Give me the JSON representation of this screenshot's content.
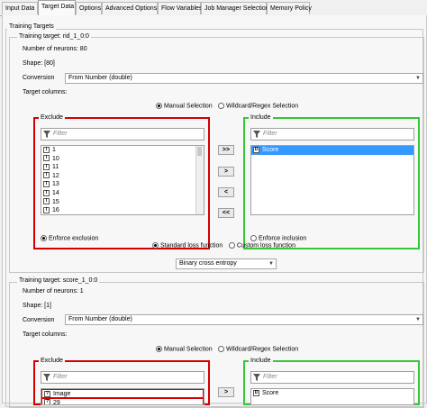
{
  "tabs": [
    "Input Data",
    "Target Data",
    "Options",
    "Advanced Options",
    "Flow Variables",
    "Job Manager Selection",
    "Memory Policy"
  ],
  "active_tab": "Target Data",
  "section_title": "Training Targets",
  "target1": {
    "title": "Training target: rid_1_0:0",
    "neurons": "Number of neurons: 80",
    "shape": "Shape: [80]",
    "conversion_label": "Conversion",
    "conversion_value": "From Number (double)",
    "target_columns_label": "Target columns:",
    "manual_selection": "Manual Selection",
    "wildcard_selection": "Wildcard/Regex Selection",
    "exclude_title": "Exclude",
    "include_title": "Include",
    "filter_placeholder": "Filter",
    "exclude_items": [
      {
        "type": "I",
        "name": "1"
      },
      {
        "type": "I",
        "name": "10"
      },
      {
        "type": "I",
        "name": "11"
      },
      {
        "type": "I",
        "name": "12"
      },
      {
        "type": "I",
        "name": "13"
      },
      {
        "type": "I",
        "name": "14"
      },
      {
        "type": "I",
        "name": "15"
      },
      {
        "type": "I",
        "name": "16"
      }
    ],
    "include_items": [
      {
        "type": "D",
        "name": "Score"
      }
    ],
    "enforce_exclusion": "Enforce exclusion",
    "enforce_inclusion": "Enforce inclusion",
    "standard_loss": "Standard loss function",
    "custom_loss": "Custom loss function",
    "loss_value": "Binary cross entropy"
  },
  "target2": {
    "title": "Training target: score_1_0:0",
    "neurons": "Number of neurons: 1",
    "shape": "Shape: [1]",
    "conversion_label": "Conversion",
    "conversion_value": "From Number (double)",
    "target_columns_label": "Target columns:",
    "manual_selection": "Manual Selection",
    "wildcard_selection": "Wildcard/Regex Selection",
    "exclude_title": "Exclude",
    "include_title": "Include",
    "filter_placeholder": "Filter",
    "exclude_items": [
      {
        "type": "?",
        "name": "Image"
      },
      {
        "type": "?",
        "name": "29"
      }
    ],
    "include_items": [
      {
        "type": "D",
        "name": "Score"
      }
    ]
  },
  "buttons": {
    "add_all": ">>",
    "add": ">",
    "remove": "<",
    "remove_all": "<<"
  }
}
